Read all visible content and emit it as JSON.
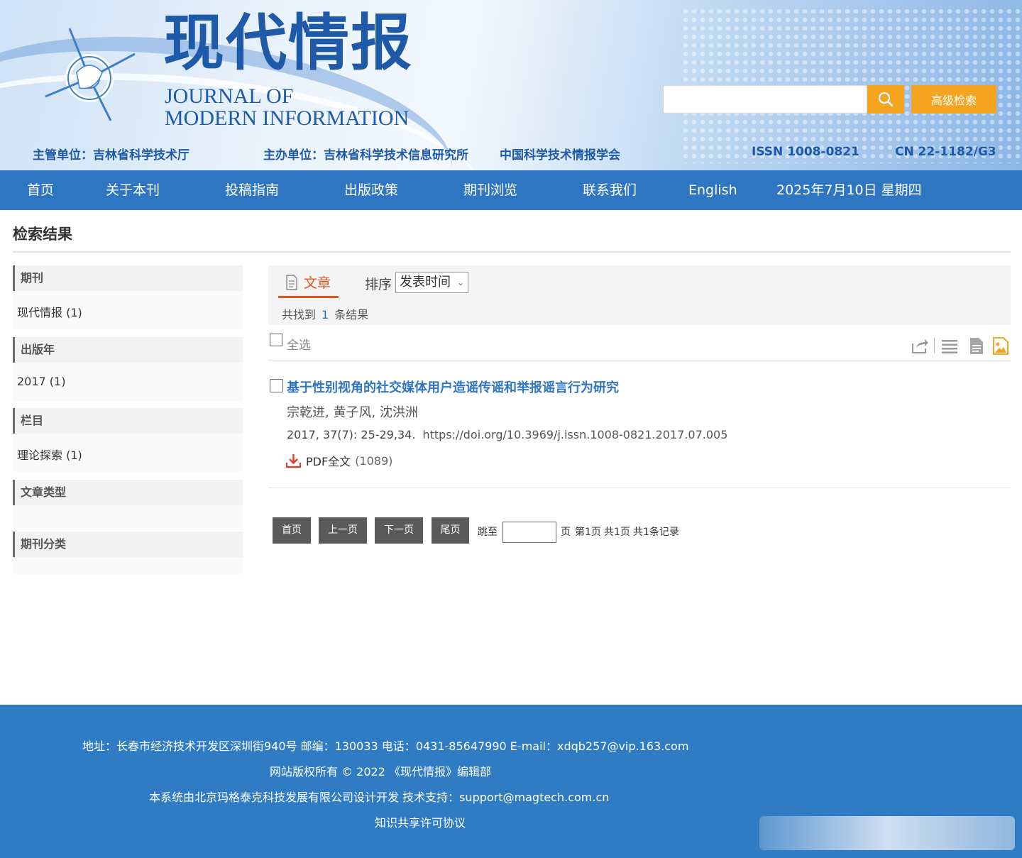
{
  "header": {
    "title_cn": "现代情报",
    "title_en_line1": "JOURNAL OF",
    "title_en_line2": "MODERN INFORMATION",
    "search": {
      "placeholder": "",
      "advanced_label": "高级检索"
    },
    "supervisor": "主管单位：吉林省科学技术厅",
    "sponsor": "主办单位：吉林省科学技术信息研究所",
    "co_sponsor": "中国科学技术情报学会",
    "issn": "ISSN 1008-0821",
    "cn": "CN 22-1182/G3"
  },
  "nav": {
    "items": [
      "首页",
      "关于本刊",
      "投稿指南",
      "出版政策",
      "期刊浏览",
      "联系我们",
      "English"
    ],
    "date": "2025年7月10日 星期四"
  },
  "page": {
    "title": "检索结果"
  },
  "facets": [
    {
      "label": "期刊",
      "items": [
        "现代情报 (1)"
      ]
    },
    {
      "label": "出版年",
      "items": [
        "2017 (1)"
      ]
    },
    {
      "label": "栏目",
      "items": [
        "理论探索 (1)"
      ]
    },
    {
      "label": "文章类型",
      "items": []
    },
    {
      "label": "期刊分类",
      "items": []
    }
  ],
  "results": {
    "tab_label": "文章",
    "sort_label": "排序",
    "sort_value": "发表时间",
    "found_prefix": "共找到",
    "found_count": "1",
    "found_suffix": "条结果",
    "select_all": "全选",
    "items": [
      {
        "title": "基于性别视角的社交媒体用户造谣传谣和举报谣言行为研究",
        "authors": "宗乾进, 黄子风, 沈洪洲",
        "citation": "2017, 37(7): 25-29,34.",
        "doi": "https://doi.org/10.3969/j.issn.1008-0821.2017.07.005",
        "pdf_label": "PDF全文",
        "pdf_count": "(1089)"
      }
    ]
  },
  "pagination": {
    "first": "首页",
    "prev": "上一页",
    "next": "下一页",
    "last": "尾页",
    "jump_label": "跳至",
    "page_unit": "页",
    "current": "第1页",
    "total_pages": "共1页",
    "total_records": "共1条记录"
  },
  "footer": {
    "address": "地址：长春市经济技术开发区深圳街940号 邮编：130033 电话：0431-85647990 E-mail：xdqb257@vip.163.com",
    "copyright": "网站版权所有 © 2022 《现代情报》编辑部",
    "developer": "本系统由北京玛格泰克科技发展有限公司设计开发 技术支持：support@magtech.com.cn",
    "license": "知识共享许可协议"
  },
  "colors": {
    "brand_blue": "#2f76c2",
    "title_blue": "#1f5aa8",
    "accent_orange": "#f5a422",
    "tab_active": "#e8541f",
    "footer_blue": "#2f7cc5"
  }
}
